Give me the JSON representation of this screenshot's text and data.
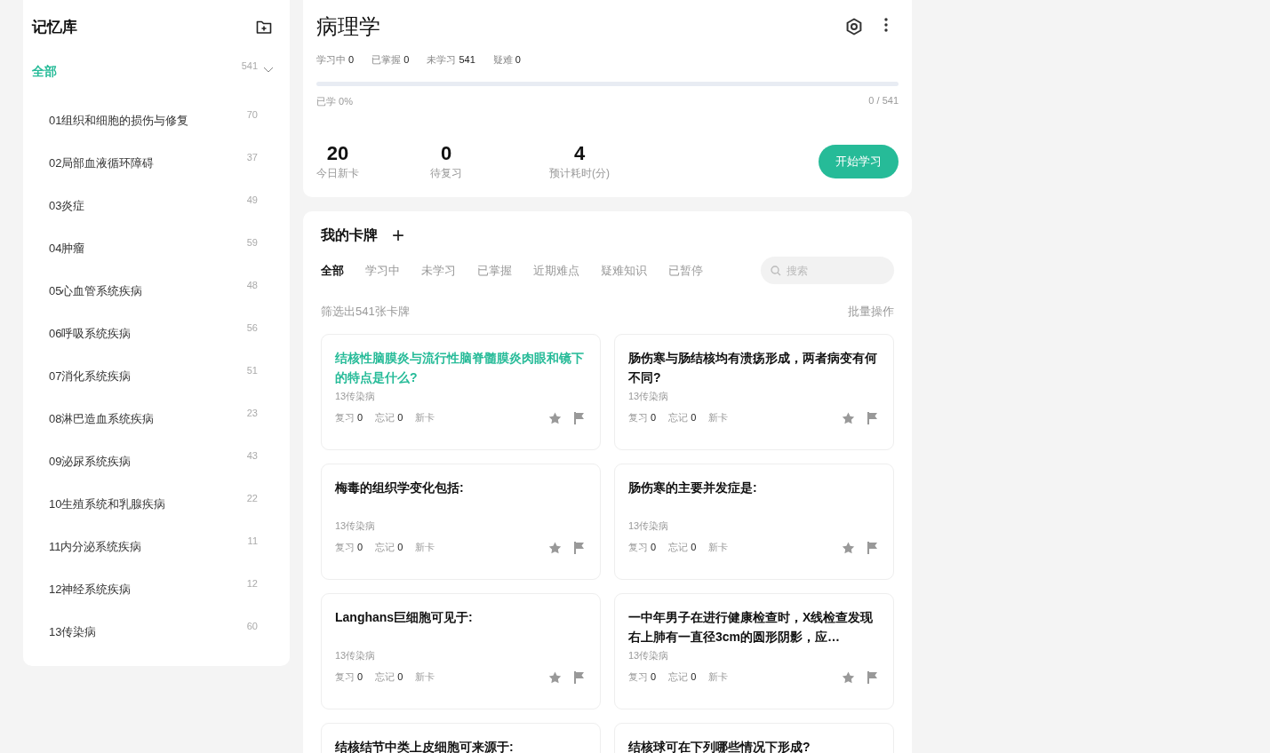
{
  "sidebar": {
    "title": "记忆库",
    "tree": {
      "label": "全部",
      "count": "541",
      "selected": true,
      "expanded": true,
      "children": [
        {
          "label": "01组织和细胞的损伤与修复",
          "count": "70",
          "selected": false
        },
        {
          "label": "02局部血液循环障碍",
          "count": "37",
          "selected": false
        },
        {
          "label": "03炎症",
          "count": "49",
          "selected": false
        },
        {
          "label": "04肿瘤",
          "count": "59",
          "selected": false
        },
        {
          "label": "05心血管系统疾病",
          "count": "48",
          "selected": false
        },
        {
          "label": "06呼吸系统疾病",
          "count": "56",
          "selected": false
        },
        {
          "label": "07消化系统疾病",
          "count": "51",
          "selected": false
        },
        {
          "label": "08淋巴造血系统疾病",
          "count": "23",
          "selected": false
        },
        {
          "label": "09泌尿系统疾病",
          "count": "43",
          "selected": false
        },
        {
          "label": "10生殖系统和乳腺疾病",
          "count": "22",
          "selected": false
        },
        {
          "label": "11内分泌系统疾病",
          "count": "11",
          "selected": false
        },
        {
          "label": "12神经系统疾病",
          "count": "12",
          "selected": false
        },
        {
          "label": "13传染病",
          "count": "60",
          "selected": false
        }
      ]
    }
  },
  "deck": {
    "title": "病理学",
    "stats": [
      {
        "label": "学习中",
        "value": "0"
      },
      {
        "label": "已掌握",
        "value": "0"
      },
      {
        "label": "未学习",
        "value": "541"
      },
      {
        "label": "疑难",
        "value": "0"
      }
    ],
    "progress": {
      "level": 0,
      "label": "已学 0%",
      "reading": "0 / 541"
    },
    "summary": [
      {
        "value": "20",
        "label": "今日新卡"
      },
      {
        "value": "0",
        "label": "待复习"
      },
      {
        "value": "4",
        "label": "预计耗时(分)"
      }
    ],
    "start_button": "开始学习"
  },
  "cards_panel": {
    "title": "我的卡牌",
    "add": "+",
    "tabs": [
      {
        "label": "全部",
        "selected": true
      },
      {
        "label": "学习中",
        "selected": false
      },
      {
        "label": "未学习",
        "selected": false
      },
      {
        "label": "已掌握",
        "selected": false
      },
      {
        "label": "近期难点",
        "selected": false
      },
      {
        "label": "疑难知识",
        "selected": false
      },
      {
        "label": "已暂停",
        "selected": false
      }
    ],
    "search": {
      "placeholder": "搜索"
    },
    "filter_count": "筛选出541张卡牌",
    "bulk": "批量操作",
    "cards": [
      {
        "title": "结核性脑膜炎与流行性脑脊髓膜炎肉眼和镜下的特点是什么?",
        "highlighted": true,
        "category": "13传染病",
        "review": [
          "复习",
          "0"
        ],
        "forget": [
          "忘记",
          "0"
        ],
        "status": "新卡"
      },
      {
        "title": "肠伤寒与肠结核均有溃疡形成，两者病变有何不同?",
        "highlighted": false,
        "category": "13传染病",
        "review": [
          "复习",
          "0"
        ],
        "forget": [
          "忘记",
          "0"
        ],
        "status": "新卡"
      },
      {
        "title": "梅毒的组织学变化包括:",
        "highlighted": false,
        "category": "13传染病",
        "review": [
          "复习",
          "0"
        ],
        "forget": [
          "忘记",
          "0"
        ],
        "status": "新卡"
      },
      {
        "title": "肠伤寒的主要并发症是:",
        "highlighted": false,
        "category": "13传染病",
        "review": [
          "复习",
          "0"
        ],
        "forget": [
          "忘记",
          "0"
        ],
        "status": "新卡"
      },
      {
        "title": "Langhans巨细胞可见于:",
        "highlighted": false,
        "category": "13传染病",
        "review": [
          "复习",
          "0"
        ],
        "forget": [
          "忘记",
          "0"
        ],
        "status": "新卡"
      },
      {
        "title": "一中年男子在进行健康检查时，X线检查发现右上肺有一直径3cm的圆形阴影，应…",
        "highlighted": false,
        "category": "13传染病",
        "review": [
          "复习",
          "0"
        ],
        "forget": [
          "忘记",
          "0"
        ],
        "status": "新卡"
      },
      {
        "title": "结核结节中类上皮细胞可来源于:",
        "highlighted": false
      },
      {
        "title": "结核球可在下列哪些情况下形成?",
        "highlighted": false
      }
    ]
  }
}
